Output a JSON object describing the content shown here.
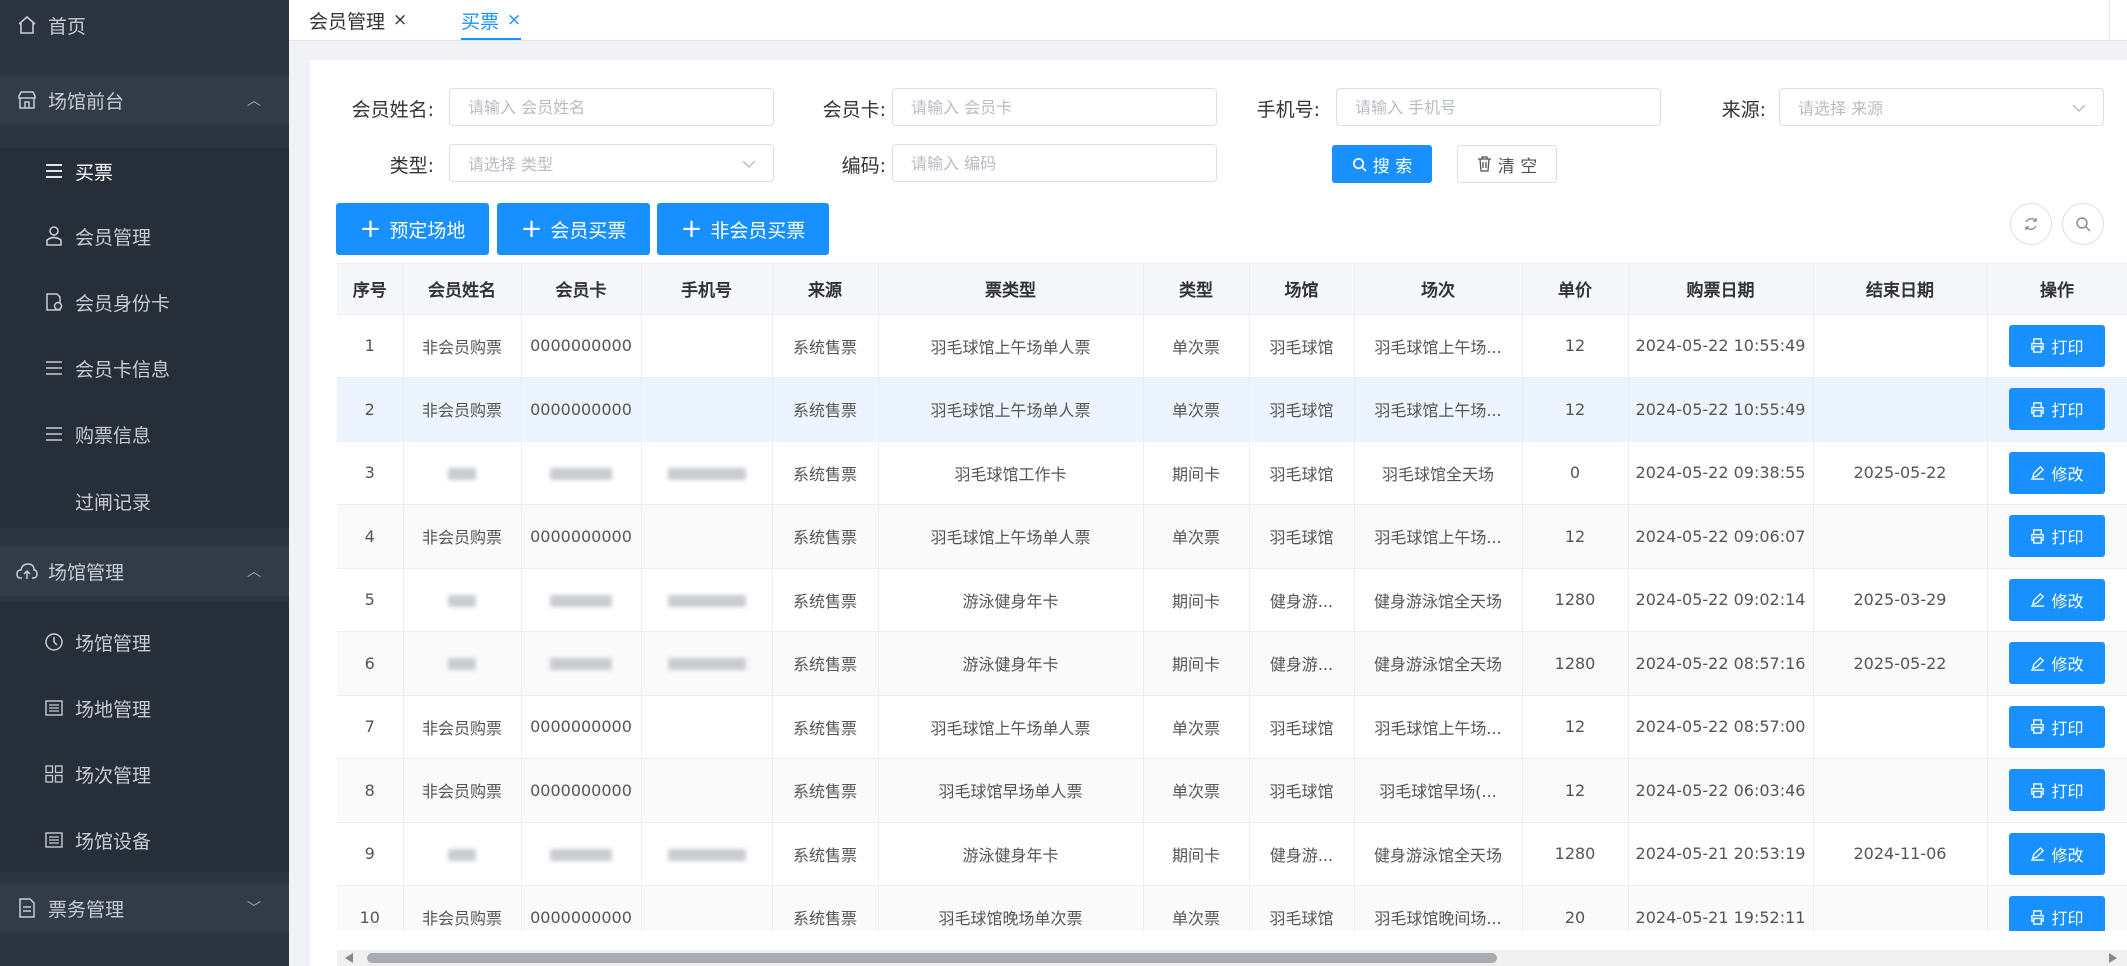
{
  "sidebar": {
    "items": [
      {
        "label": "首页",
        "icon": "home-icon"
      },
      {
        "label": "场馆前台",
        "icon": "store-icon"
      },
      {
        "label": "买票",
        "icon": "menu-icon"
      },
      {
        "label": "会员管理",
        "icon": "user-icon"
      },
      {
        "label": "会员身份卡",
        "icon": "id-card-icon"
      },
      {
        "label": "会员卡信息",
        "icon": "menu-icon"
      },
      {
        "label": "购票信息",
        "icon": "menu-icon"
      },
      {
        "label": "过闸记录",
        "icon": ""
      },
      {
        "label": "场馆管理",
        "icon": "cloud-upload-icon"
      },
      {
        "label": "场馆管理",
        "icon": "clock-icon"
      },
      {
        "label": "场地管理",
        "icon": "list-icon"
      },
      {
        "label": "场次管理",
        "icon": "grid-icon"
      },
      {
        "label": "场馆设备",
        "icon": "list-icon"
      },
      {
        "label": "票务管理",
        "icon": "document-icon"
      }
    ]
  },
  "tabs": [
    {
      "label": "会员管理",
      "close": "×"
    },
    {
      "label": "买票",
      "close": "×"
    }
  ],
  "filters": {
    "member_name": {
      "label": "会员姓名:",
      "placeholder": "请输入 会员姓名"
    },
    "member_card": {
      "label": "会员卡:",
      "placeholder": "请输入 会员卡"
    },
    "phone": {
      "label": "手机号:",
      "placeholder": "请输入 手机号"
    },
    "source": {
      "label": "来源:",
      "placeholder": "请选择 来源"
    },
    "type": {
      "label": "类型:",
      "placeholder": "请选择 类型"
    },
    "code": {
      "label": "编码:",
      "placeholder": "请输入 编码"
    },
    "search_label": "搜 索",
    "clear_label": "清 空"
  },
  "actions": {
    "book_venue": "预定场地",
    "member_ticket": "会员买票",
    "nonmember_ticket": "非会员买票"
  },
  "table": {
    "headers": [
      "序号",
      "会员姓名",
      "会员卡",
      "手机号",
      "来源",
      "票类型",
      "类型",
      "场馆",
      "场次",
      "单价",
      "购票日期",
      "结束日期",
      "操作"
    ],
    "rows": [
      {
        "no": "1",
        "name": "非会员购票",
        "card": "0000000000",
        "phone": "",
        "source": "系统售票",
        "ticket_type": "羽毛球馆上午场单人票",
        "type": "单次票",
        "venue": "羽毛球馆",
        "session": "羽毛球馆上午场...",
        "price": "12",
        "buy_date": "2024-05-22 10:55:49",
        "end_date": "",
        "op": "打印"
      },
      {
        "no": "2",
        "name": "非会员购票",
        "card": "0000000000",
        "phone": "",
        "source": "系统售票",
        "ticket_type": "羽毛球馆上午场单人票",
        "type": "单次票",
        "venue": "羽毛球馆",
        "session": "羽毛球馆上午场...",
        "price": "12",
        "buy_date": "2024-05-22 10:55:49",
        "end_date": "",
        "op": "打印"
      },
      {
        "no": "3",
        "name": "",
        "card": "",
        "phone": "",
        "source": "系统售票",
        "ticket_type": "羽毛球馆工作卡",
        "type": "期间卡",
        "venue": "羽毛球馆",
        "session": "羽毛球馆全天场",
        "price": "0",
        "buy_date": "2024-05-22 09:38:55",
        "end_date": "2025-05-22",
        "op": "修改"
      },
      {
        "no": "4",
        "name": "非会员购票",
        "card": "0000000000",
        "phone": "",
        "source": "系统售票",
        "ticket_type": "羽毛球馆上午场单人票",
        "type": "单次票",
        "venue": "羽毛球馆",
        "session": "羽毛球馆上午场...",
        "price": "12",
        "buy_date": "2024-05-22 09:06:07",
        "end_date": "",
        "op": "打印"
      },
      {
        "no": "5",
        "name": "",
        "card": "",
        "phone": "",
        "source": "系统售票",
        "ticket_type": "游泳健身年卡",
        "type": "期间卡",
        "venue": "健身游...",
        "session": "健身游泳馆全天场",
        "price": "1280",
        "buy_date": "2024-05-22 09:02:14",
        "end_date": "2025-03-29",
        "op": "修改"
      },
      {
        "no": "6",
        "name": "",
        "card": "",
        "phone": "",
        "source": "系统售票",
        "ticket_type": "游泳健身年卡",
        "type": "期间卡",
        "venue": "健身游...",
        "session": "健身游泳馆全天场",
        "price": "1280",
        "buy_date": "2024-05-22 08:57:16",
        "end_date": "2025-05-22",
        "op": "修改"
      },
      {
        "no": "7",
        "name": "非会员购票",
        "card": "0000000000",
        "phone": "",
        "source": "系统售票",
        "ticket_type": "羽毛球馆上午场单人票",
        "type": "单次票",
        "venue": "羽毛球馆",
        "session": "羽毛球馆上午场...",
        "price": "12",
        "buy_date": "2024-05-22 08:57:00",
        "end_date": "",
        "op": "打印"
      },
      {
        "no": "8",
        "name": "非会员购票",
        "card": "0000000000",
        "phone": "",
        "source": "系统售票",
        "ticket_type": "羽毛球馆早场单人票",
        "type": "单次票",
        "venue": "羽毛球馆",
        "session": "羽毛球馆早场(...",
        "price": "12",
        "buy_date": "2024-05-22 06:03:46",
        "end_date": "",
        "op": "打印"
      },
      {
        "no": "9",
        "name": "",
        "card": "",
        "phone": "",
        "source": "系统售票",
        "ticket_type": "游泳健身年卡",
        "type": "期间卡",
        "venue": "健身游...",
        "session": "健身游泳馆全天场",
        "price": "1280",
        "buy_date": "2024-05-21 20:53:19",
        "end_date": "2024-11-06",
        "op": "修改"
      },
      {
        "no": "10",
        "name": "非会员购票",
        "card": "0000000000",
        "phone": "",
        "source": "系统售票",
        "ticket_type": "羽毛球馆晚场单次票",
        "type": "单次票",
        "venue": "羽毛球馆",
        "session": "羽毛球馆晚间场...",
        "price": "20",
        "buy_date": "2024-05-21 19:52:11",
        "end_date": "",
        "op": "打印"
      }
    ]
  },
  "colors": {
    "primary": "#1890ff",
    "sidebar_bg": "#2b3440"
  }
}
